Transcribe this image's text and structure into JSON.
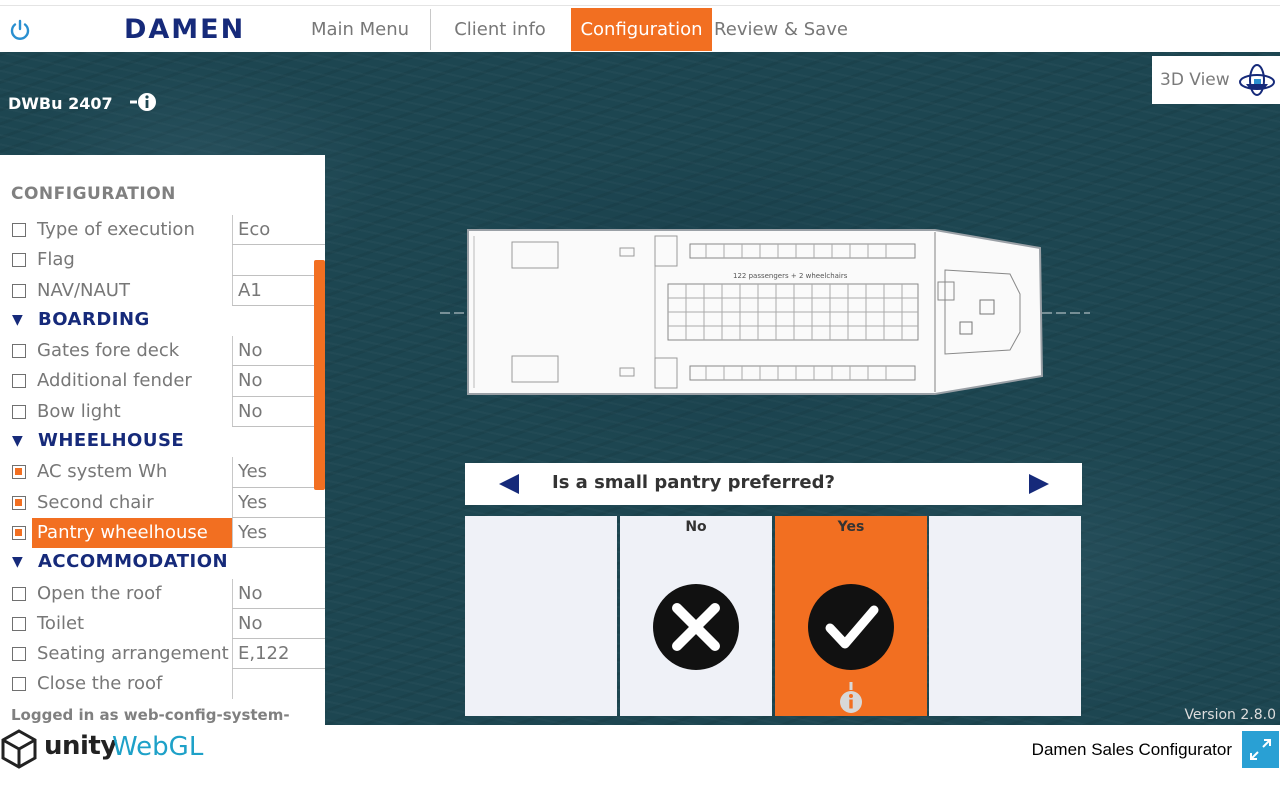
{
  "topbar": {
    "logo": "DAMEN",
    "nav": [
      {
        "label": "Main Menu",
        "active": false
      },
      {
        "label": "Client info",
        "active": false
      },
      {
        "label": "Configuration",
        "active": true
      },
      {
        "label": "Review & Save",
        "active": false
      }
    ]
  },
  "view": {
    "vessel_name": "DWBu 2407",
    "view3d_label": "3D View",
    "ship_caption": "122 passengers + 2 wheelchairs",
    "version": "Version 2.8.0"
  },
  "panel": {
    "title": "CONFIGURATION",
    "rows": [
      {
        "type": "item",
        "label": "Type of execution",
        "value": "Eco",
        "checked": false,
        "selected": false
      },
      {
        "type": "item",
        "label": "Flag",
        "value": "",
        "checked": false,
        "selected": false
      },
      {
        "type": "item",
        "label": "NAV/NAUT",
        "value": "A1",
        "checked": false,
        "selected": false
      },
      {
        "type": "section",
        "label": "BOARDING"
      },
      {
        "type": "item",
        "label": "Gates fore deck",
        "value": "No",
        "checked": false,
        "selected": false
      },
      {
        "type": "item",
        "label": "Additional fender",
        "value": "No",
        "checked": false,
        "selected": false
      },
      {
        "type": "item",
        "label": "Bow light",
        "value": "No",
        "checked": false,
        "selected": false
      },
      {
        "type": "section",
        "label": "WHEELHOUSE"
      },
      {
        "type": "item",
        "label": "AC system Wh",
        "value": "Yes",
        "checked": true,
        "selected": false
      },
      {
        "type": "item",
        "label": "Second chair",
        "value": "Yes",
        "checked": true,
        "selected": false
      },
      {
        "type": "item",
        "label": "Pantry wheelhouse",
        "value": "Yes",
        "checked": true,
        "selected": true
      },
      {
        "type": "section",
        "label": "ACCOMMODATION"
      },
      {
        "type": "item",
        "label": "Open the roof",
        "value": "No",
        "checked": false,
        "selected": false
      },
      {
        "type": "item",
        "label": "Toilet",
        "value": "No",
        "checked": false,
        "selected": false
      },
      {
        "type": "item",
        "label": "Seating arrangement",
        "value": "E,122",
        "checked": false,
        "selected": false
      },
      {
        "type": "item",
        "label": "Close the roof",
        "value": "",
        "checked": false,
        "selected": false
      }
    ],
    "logged_in": "Logged in as web-config-system-user"
  },
  "question": {
    "text": "Is a small pantry preferred?",
    "options": [
      {
        "label": "",
        "icon": "",
        "selected": false
      },
      {
        "label": "No",
        "icon": "x-circle-icon",
        "selected": false
      },
      {
        "label": "Yes",
        "icon": "check-circle-icon",
        "selected": true
      },
      {
        "label": "",
        "icon": "",
        "selected": false
      }
    ]
  },
  "footer": {
    "unity": "unity",
    "webgl": "WebGL",
    "app_name": "Damen Sales Configurator"
  },
  "colors": {
    "accent": "#f26f21",
    "brand": "#162a7a",
    "sea": "#1d4651",
    "webgl": "#1ea1c8",
    "fullscreen": "#29a0d4"
  }
}
